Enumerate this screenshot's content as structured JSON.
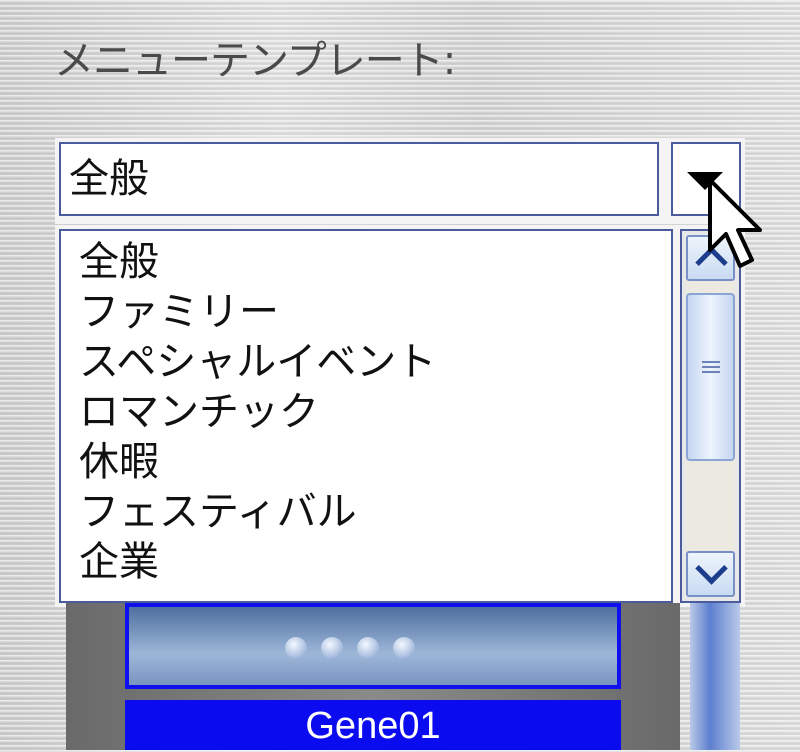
{
  "heading": "メニューテンプレート:",
  "combo": {
    "selected_value": "全般"
  },
  "dropdown": {
    "options": [
      "全般",
      "ファミリー",
      "スペシャルイベント",
      "ロマンチック",
      "休暇",
      "フェスティバル",
      "企業"
    ]
  },
  "preview": {
    "caption": "Gene01"
  },
  "colors": {
    "border": "#4a5c9c",
    "caption_bg": "#0b0bf0",
    "thumb_border": "#1010ee"
  },
  "icons": {
    "combo_button": "dropdown-arrow-icon",
    "scroll_up": "chevron-up-icon",
    "scroll_down": "chevron-down-icon",
    "thumb": "scroll-grip-icon",
    "cursor": "mouse-pointer-icon"
  }
}
